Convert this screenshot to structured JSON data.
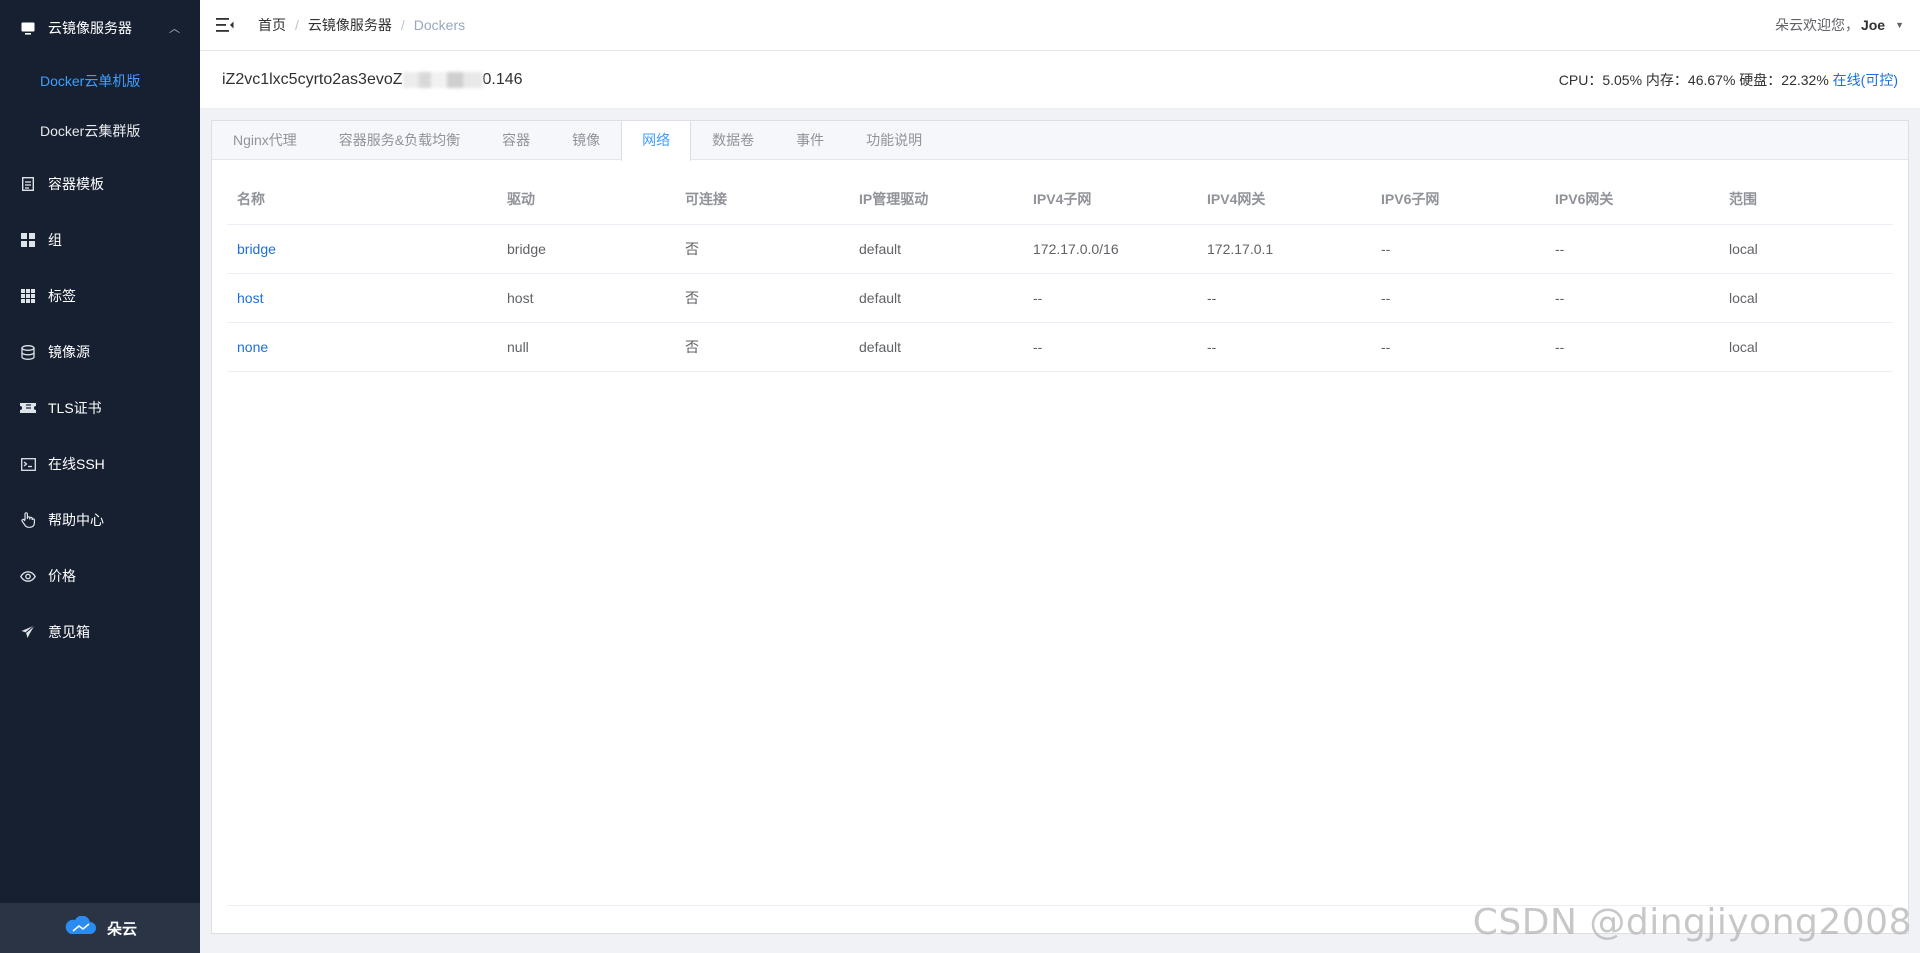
{
  "sidebar": {
    "group": {
      "label": "云镜像服务器",
      "icon": "monitor-icon",
      "expanded": true
    },
    "sub_items": [
      {
        "label": "Docker云单机版",
        "active": true
      },
      {
        "label": "Docker云集群版",
        "active": false
      }
    ],
    "items": [
      {
        "label": "容器模板",
        "icon": "document-icon"
      },
      {
        "label": "组",
        "icon": "grid-icon"
      },
      {
        "label": "标签",
        "icon": "apps-icon"
      },
      {
        "label": "镜像源",
        "icon": "database-icon"
      },
      {
        "label": "TLS证书",
        "icon": "ticket-icon"
      },
      {
        "label": "在线SSH",
        "icon": "terminal-icon"
      },
      {
        "label": "帮助中心",
        "icon": "pointer-hand-icon"
      },
      {
        "label": "价格",
        "icon": "eye-icon"
      },
      {
        "label": "意见箱",
        "icon": "send-icon"
      }
    ],
    "footer": {
      "label": "朵云",
      "icon": "cloud-logo-icon"
    }
  },
  "header": {
    "breadcrumbs": [
      "首页",
      "云镜像服务器",
      "Dockers"
    ],
    "greeting": "朵云欢迎您，",
    "username": "Joe"
  },
  "server": {
    "hostname_prefix": "iZ2vc1lxc5cyrto2as3evoZ",
    "hostname_suffix": "0.146",
    "stats_text": "CPU：5.05% 内存：46.67% 硬盘：22.32%",
    "status_link": "在线(可控)"
  },
  "tabs": [
    {
      "label": "Nginx代理",
      "active": false
    },
    {
      "label": "容器服务&负载均衡",
      "active": false
    },
    {
      "label": "容器",
      "active": false
    },
    {
      "label": "镜像",
      "active": false
    },
    {
      "label": "网络",
      "active": true
    },
    {
      "label": "数据卷",
      "active": false
    },
    {
      "label": "事件",
      "active": false
    },
    {
      "label": "功能说明",
      "active": false
    }
  ],
  "table": {
    "columns": [
      "名称",
      "驱动",
      "可连接",
      "IP管理驱动",
      "IPV4子网",
      "IPV4网关",
      "IPV6子网",
      "IPV6网关",
      "范围"
    ],
    "rows": [
      [
        "bridge",
        "bridge",
        "否",
        "default",
        "172.17.0.0/16",
        "172.17.0.1",
        "--",
        "--",
        "local"
      ],
      [
        "host",
        "host",
        "否",
        "default",
        "--",
        "--",
        "--",
        "--",
        "local"
      ],
      [
        "none",
        "null",
        "否",
        "default",
        "--",
        "--",
        "--",
        "--",
        "local"
      ]
    ]
  },
  "watermark": "CSDN @dingjiyong2008",
  "colors": {
    "sidebar_bg": "#172031",
    "accent": "#409eff",
    "link": "#1e6fdb"
  }
}
